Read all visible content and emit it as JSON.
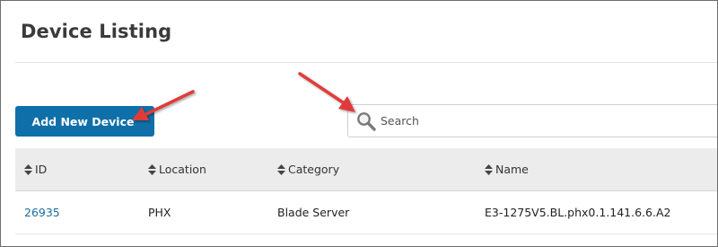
{
  "page": {
    "title": "Device Listing"
  },
  "toolbar": {
    "add_label": "Add New Device",
    "search_placeholder": "Search",
    "search_value": ""
  },
  "table": {
    "columns": [
      "ID",
      "Location",
      "Category",
      "Name"
    ],
    "rows": [
      {
        "id": "26935",
        "location": "PHX",
        "category": "Blade Server",
        "name": "E3-1275V5.BL.phx0.1.141.6.6.A2"
      }
    ]
  },
  "colors": {
    "accent": "#0f6fa8",
    "link": "#1a6f9b",
    "annotation_arrow": "#e03a3a",
    "header_bg": "#ececec"
  },
  "icons": {
    "search": "search-icon",
    "sort": "sort-icon"
  }
}
